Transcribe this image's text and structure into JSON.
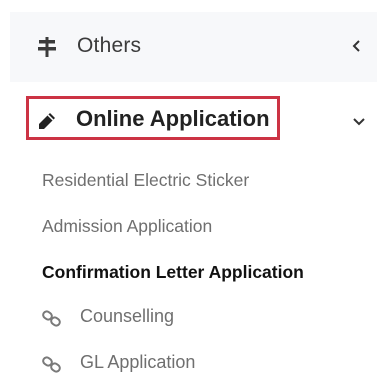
{
  "nav": {
    "others": {
      "label": "Others",
      "icon": "signpost-icon",
      "chevron": "chevron-left-icon"
    },
    "online_application": {
      "label": "Online Application",
      "icon": "pencil-icon",
      "chevron": "chevron-down-icon",
      "highlight_color": "#cc3344",
      "sub_items": [
        {
          "label": "Residential Electric Sticker",
          "active": false
        },
        {
          "label": "Admission Application",
          "active": false
        },
        {
          "label": "Confirmation Letter Application",
          "active": true
        }
      ],
      "link_items": [
        {
          "label": "Counselling",
          "icon": "link-icon"
        },
        {
          "label": "GL Application",
          "icon": "link-icon"
        }
      ]
    }
  },
  "colors": {
    "row_background": "#f7f8fa",
    "inactive_text": "#6f6f6f",
    "active_text": "#111111"
  }
}
